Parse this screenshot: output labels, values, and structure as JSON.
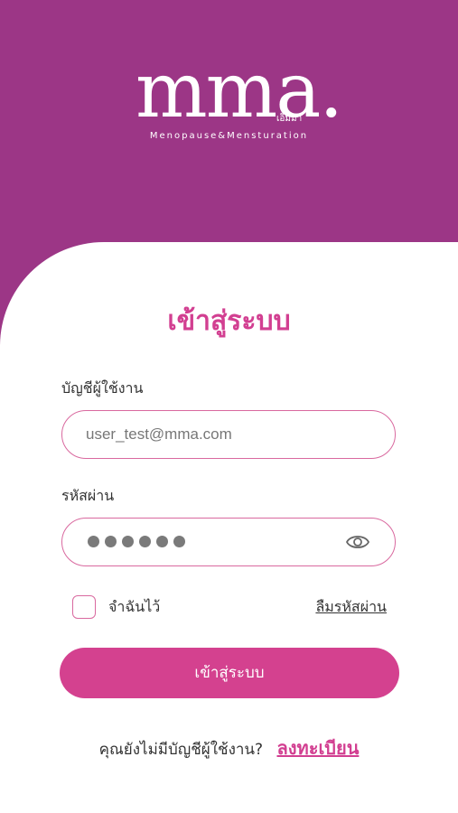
{
  "brand": {
    "thai_name": "เอ็มม่า",
    "wordmark": "mma.",
    "tagline": "Menopause&Mensturation"
  },
  "colors": {
    "header_bg": "#9c3686",
    "accent": "#d23f91",
    "button_bg": "#d4418f",
    "field_border": "#d9699f"
  },
  "login": {
    "title": "เข้าสู่ระบบ",
    "account_label": "บัญชีผู้ใช้งาน",
    "account_value": "user_test@mma.com",
    "password_label": "รหัสผ่าน",
    "password_masked_length": 6,
    "toggle_icon": "eye-icon",
    "remember_label": "จำฉันไว้",
    "remember_checked": false,
    "forgot_label": "ลืมรหัสผ่าน",
    "submit_label": "เข้าสู่ระบบ"
  },
  "signup": {
    "prompt": "คุณยังไม่มีบัญชีผู้ใช้งาน?",
    "link_label": "ลงทะเบียน"
  }
}
